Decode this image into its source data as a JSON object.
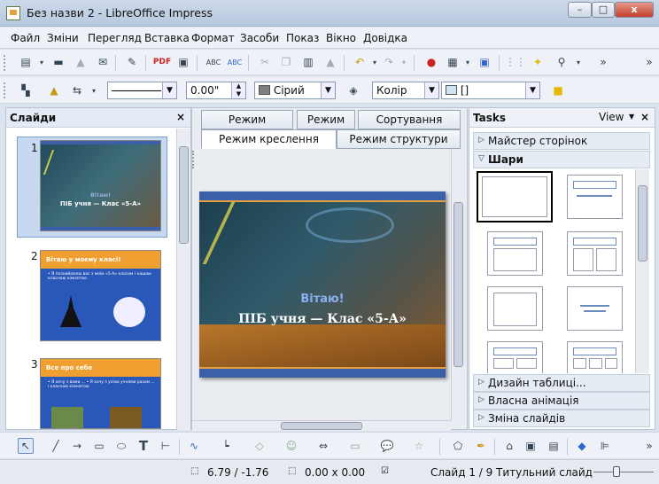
{
  "window": {
    "title": "Без назви 2 - LibreOffice Impress",
    "min": "–",
    "max": "□",
    "close": "x"
  },
  "menu": [
    "Файл",
    "Зміни",
    "Перегляд",
    "Вставка",
    "Формат",
    "Засоби",
    "Показ",
    "Вікно",
    "Довідка"
  ],
  "line_toolbar": {
    "line_style": "",
    "line_width": "0.00\"",
    "color_name": "Сірий",
    "fill_type": "Колір",
    "fill_value": "[]"
  },
  "slides_panel": {
    "title": "Слайди",
    "close": "×",
    "slides": [
      {
        "num": "1",
        "heading": "Вітаю!",
        "subtitle": "ПІБ учня — Клас «5-А»"
      },
      {
        "num": "2",
        "heading": "Вітаю у моєму класі!",
        "subtitle": "• Я познайомлю вас з моїм «5-А» класом і нашою класною кімнатою."
      },
      {
        "num": "3",
        "heading": "Все про себе",
        "subtitle": "• Я хочу з вами ... • Я хочу з усіма учнями разом ... і класною кімнатою"
      }
    ]
  },
  "tabs": {
    "row1": [
      "Режим приміток",
      "Режим тез",
      "Сортування слайду"
    ],
    "row2": [
      "Режим креслення",
      "Режим структури"
    ]
  },
  "main_slide": {
    "heading": "Вітаю!",
    "subtitle": "ПІБ учня — Клас «5-А»"
  },
  "tasks": {
    "title": "Tasks",
    "view": "View",
    "close": "×",
    "sections": [
      {
        "label": "Майстер сторінок",
        "open": false
      },
      {
        "label": "Шари",
        "open": true
      },
      {
        "label": "Дизайн таблиці...",
        "open": false
      },
      {
        "label": "Власна анімація",
        "open": false
      },
      {
        "label": "Зміна слайдів",
        "open": false
      }
    ]
  },
  "status": {
    "position": "6.79 / -1.76",
    "size": "0.00 x 0.00",
    "slide": "Слайд 1 / 9",
    "layout": "Титульний слайд"
  },
  "colors": {
    "accent": "#3b5fa8",
    "titlebar": "#c1d0e4"
  }
}
